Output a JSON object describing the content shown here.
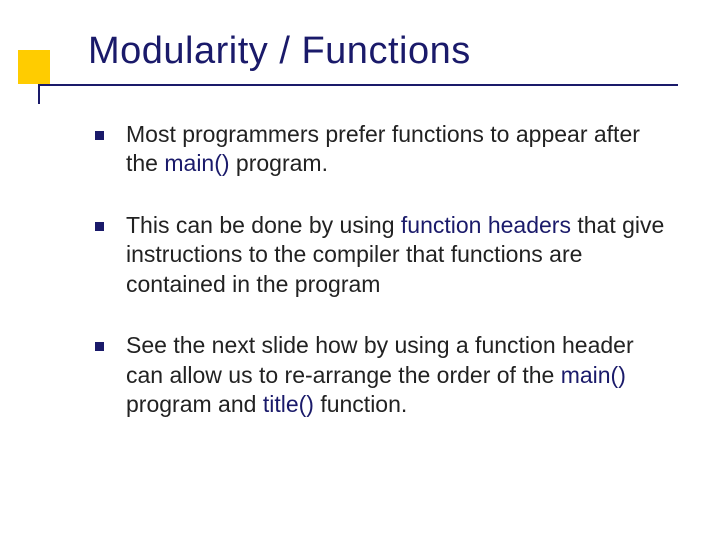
{
  "title": "Modularity / Functions",
  "bullets": {
    "b1": {
      "t1": "Most programmers prefer functions to appear after the ",
      "k1": "main()",
      "t2": " program."
    },
    "b2": {
      "t1": "This can be done by using ",
      "k1": "function headers",
      "t2": " that give instructions to the compiler that functions are contained in the program"
    },
    "b3": {
      "t1": "See the next slide how by using a function header can allow us to re-arrange the order of the ",
      "k1": "main()",
      "t2": " program and ",
      "k2": "title()",
      "t3": " function."
    }
  }
}
